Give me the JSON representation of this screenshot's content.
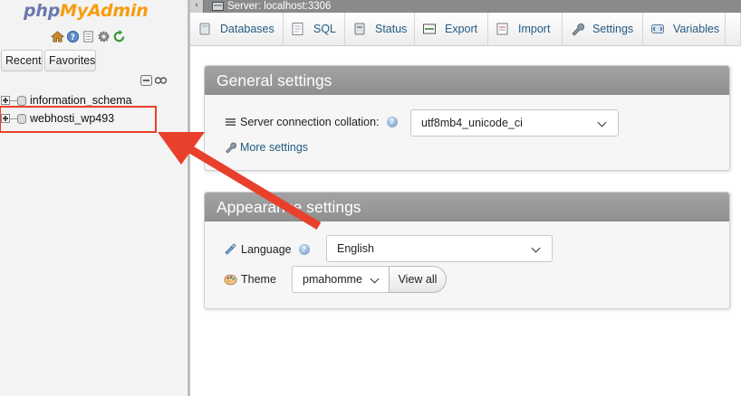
{
  "app": {
    "logo_part1": "php",
    "logo_part2": "MyAdmin"
  },
  "nav": {
    "quick_icons": [
      "home-icon",
      "logout-icon",
      "docs-icon",
      "settings-icon",
      "reload-icon"
    ],
    "recent_label": "Recent",
    "favorites_label": "Favorites",
    "tree_tools": [
      "collapse-all-icon",
      "link-icon"
    ],
    "databases": [
      {
        "name": "information_schema"
      },
      {
        "name": "webhosti_wp493"
      }
    ]
  },
  "topbar": {
    "collapse_glyph": "‹",
    "server": "Server: localhost:3306"
  },
  "tabs": [
    {
      "label": "Databases",
      "icon": "databases-icon"
    },
    {
      "label": "SQL",
      "icon": "sql-icon"
    },
    {
      "label": "Status",
      "icon": "status-icon"
    },
    {
      "label": "Export",
      "icon": "export-icon"
    },
    {
      "label": "Import",
      "icon": "import-icon"
    },
    {
      "label": "Settings",
      "icon": "wrench-icon"
    },
    {
      "label": "Variables",
      "icon": "variables-icon"
    }
  ],
  "general": {
    "title": "General settings",
    "collation_label": "Server connection collation:",
    "collation_value": "utf8mb4_unicode_ci",
    "more_settings": "More settings"
  },
  "appearance": {
    "title": "Appearance settings",
    "language_label": "Language",
    "language_value": "English",
    "theme_label": "Theme",
    "theme_value": "pmahomme",
    "view_all": "View all"
  },
  "colors": {
    "link": "#235a81",
    "annotation": "#e8402a",
    "panel_header": "#999999"
  }
}
